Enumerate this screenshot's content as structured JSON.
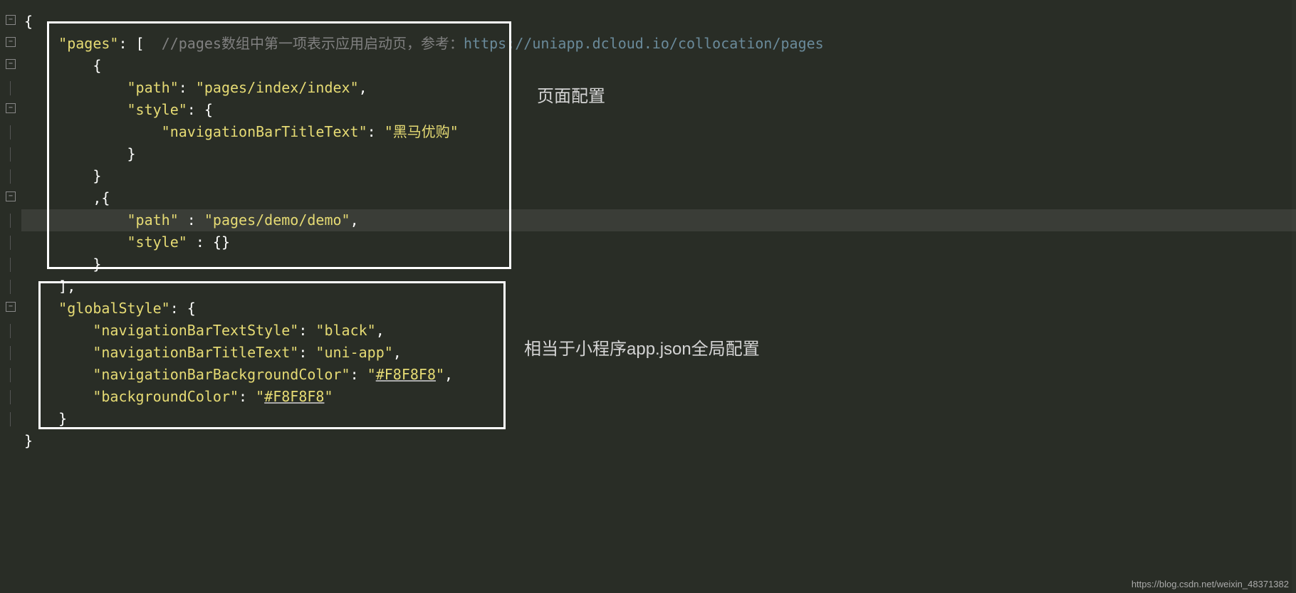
{
  "code": {
    "l1": "{",
    "l2_key": "\"pages\"",
    "l2_punct": ": [  ",
    "l2_comment": "//pages数组中第一项表示应用启动页，参考：",
    "l2_url": "https://uniapp.dcloud.io/collocation/pages",
    "l3": "        {",
    "l4_indent": "            ",
    "l4_key": "\"path\"",
    "l4_mid": ": ",
    "l4_val": "\"pages/index/index\"",
    "l4_end": ",",
    "l5_indent": "            ",
    "l5_key": "\"style\"",
    "l5_end": ": {",
    "l6_indent": "                ",
    "l6_key": "\"navigationBarTitleText\"",
    "l6_mid": ": ",
    "l6_val": "\"黑马优购\"",
    "l7": "            }",
    "l8": "        }",
    "l9": "        ,{",
    "l10_indent": "            ",
    "l10_key": "\"path\"",
    "l10_mid": " : ",
    "l10_val": "\"pages/demo/demo\"",
    "l10_end": ",",
    "l11_indent": "            ",
    "l11_key": "\"style\"",
    "l11_end": " : {}",
    "l12": "        }",
    "l13": "    ],",
    "l14_indent": "    ",
    "l14_key": "\"globalStyle\"",
    "l14_end": ": {",
    "l15_indent": "        ",
    "l15_key": "\"navigationBarTextStyle\"",
    "l15_mid": ": ",
    "l15_val": "\"black\"",
    "l15_end": ",",
    "l16_indent": "        ",
    "l16_key": "\"navigationBarTitleText\"",
    "l16_mid": ": ",
    "l16_val": "\"uni-app\"",
    "l16_end": ",",
    "l17_indent": "        ",
    "l17_key": "\"navigationBarBackgroundColor\"",
    "l17_mid": ": ",
    "l17_q": "\"",
    "l17_val": "#F8F8F8",
    "l17_end": ",",
    "l18_indent": "        ",
    "l18_key": "\"backgroundColor\"",
    "l18_mid": ": ",
    "l18_q": "\"",
    "l18_val": "#F8F8F8",
    "l19": "    }",
    "l20": "}"
  },
  "labels": {
    "page_config": "页面配置",
    "global_config": "相当于小程序app.json全局配置"
  },
  "watermark": "https://blog.csdn.net/weixin_48371382"
}
